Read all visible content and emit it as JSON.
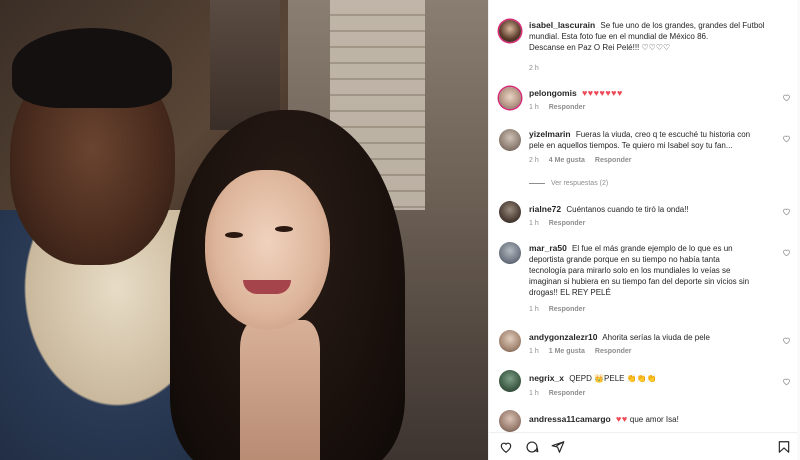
{
  "post": {
    "author": "isabel_lascurain",
    "caption_line1": "Se fue uno de los grandes, grandes del Futbol",
    "caption_line2": "mundial. Esta foto fue en el mundial de México 86.",
    "caption_line3": "Descanse en Paz O Rei Pelé!!! ♡♡♡♡",
    "time": "2 h"
  },
  "comments": [
    {
      "user": "pelongomis",
      "text": "♥♥♥♥♥♥♥",
      "time": "1 h",
      "reply": "Responder"
    },
    {
      "user": "yizelmarin",
      "line1": "Fueras la viuda, creo q te escuché tu historia con",
      "line2": "pele en aquellos tiempos. Te quiero mi Isabel soy tu fan...",
      "time": "2 h",
      "likes": "4 Me gusta",
      "reply": "Responder",
      "view_replies": "Ver respuestas (2)"
    },
    {
      "user": "rialne72",
      "text": "Cuéntanos cuando te tiró la onda!!",
      "time": "1 h",
      "reply": "Responder"
    },
    {
      "user": "mar_ra50",
      "line1": "El fue el más grande ejemplo de lo que es un",
      "line2": "deportista grande porque en su tiempo no había tanta",
      "line3": "tecnología para mirarlo solo en los mundiales lo veías se",
      "line4": "imaginan si hubiera en su tiempo fan del deporte sin vicios sin",
      "line5": "drogas!! EL REY PELÉ",
      "time": "1 h",
      "reply": "Responder"
    },
    {
      "user": "andygonzalezr10",
      "text": "Ahorita serías la viuda de pele",
      "time": "1 h",
      "likes": "1 Me gusta",
      "reply": "Responder"
    },
    {
      "user": "negrix_x",
      "text": "QEPD 👑PELE 👏👏👏",
      "time": "1 h",
      "reply": "Responder"
    },
    {
      "user": "andressa11camargo",
      "hearts": "♥♥",
      "text": "que amor Isa!"
    }
  ],
  "icons": {
    "like": "heart-icon",
    "comment": "comment-icon",
    "share": "share-icon",
    "save": "bookmark-icon"
  },
  "colors": {
    "heart_red": "#ed4956",
    "story_ring": "#d62976",
    "meta_gray": "#8e8e8e"
  }
}
